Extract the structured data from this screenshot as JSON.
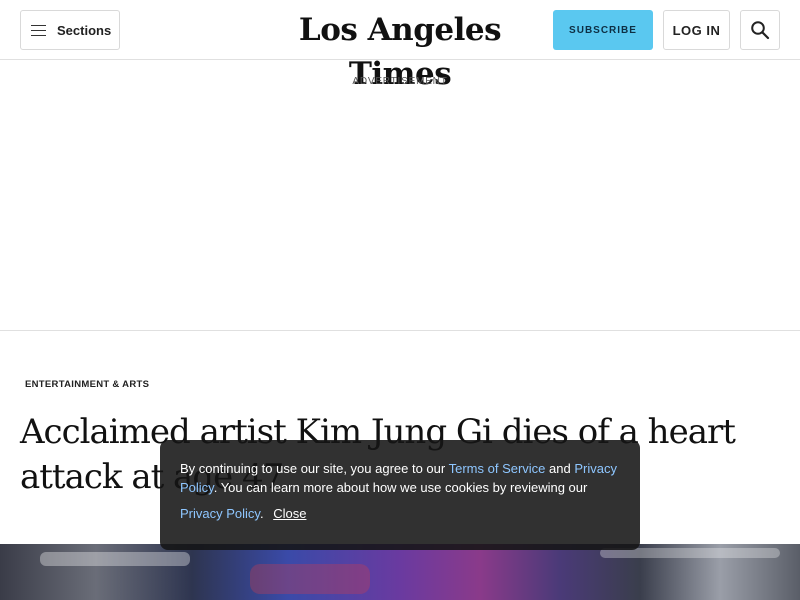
{
  "header": {
    "sections_label": "Sections",
    "logo_text": "Los Angeles Times",
    "subscribe_label": "SUBSCRIBE",
    "login_label": "LOG IN",
    "search_icon": "search-icon",
    "menu_icon": "hamburger-menu-icon"
  },
  "ad": {
    "label": "ADVERTISEMENT"
  },
  "article": {
    "section_tag": "ENTERTAINMENT & ARTS",
    "headline": "Acclaimed artist Kim Jung Gi dies of a heart attack at age 47"
  },
  "cookie_banner": {
    "text_1": "By continuing to use our site, you agree to our ",
    "terms_link": "Terms of Service",
    "text_2": " and ",
    "privacy_link_1": "Privacy Policy",
    "text_3": ". You can learn more about how we use cookies by reviewing our ",
    "privacy_link_2": "Privacy Policy",
    "text_4": ".",
    "close_label": "Close"
  },
  "colors": {
    "subscribe_bg": "#5ac8f0",
    "link": "#8ec6ff",
    "banner_bg": "#141414"
  }
}
